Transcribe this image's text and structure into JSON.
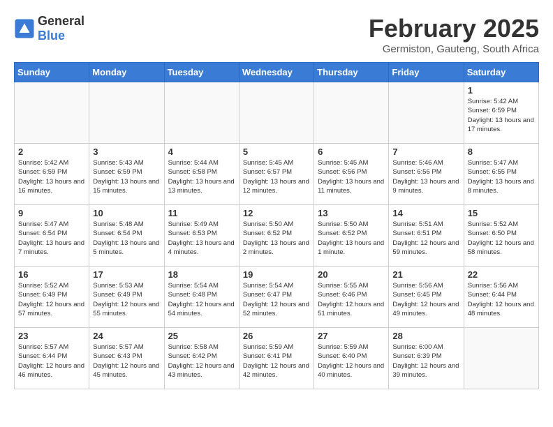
{
  "logo": {
    "general": "General",
    "blue": "Blue"
  },
  "title": "February 2025",
  "subtitle": "Germiston, Gauteng, South Africa",
  "weekdays": [
    "Sunday",
    "Monday",
    "Tuesday",
    "Wednesday",
    "Thursday",
    "Friday",
    "Saturday"
  ],
  "weeks": [
    [
      {
        "day": "",
        "info": ""
      },
      {
        "day": "",
        "info": ""
      },
      {
        "day": "",
        "info": ""
      },
      {
        "day": "",
        "info": ""
      },
      {
        "day": "",
        "info": ""
      },
      {
        "day": "",
        "info": ""
      },
      {
        "day": "1",
        "info": "Sunrise: 5:42 AM\nSunset: 6:59 PM\nDaylight: 13 hours\nand 17 minutes."
      }
    ],
    [
      {
        "day": "2",
        "info": "Sunrise: 5:42 AM\nSunset: 6:59 PM\nDaylight: 13 hours\nand 16 minutes."
      },
      {
        "day": "3",
        "info": "Sunrise: 5:43 AM\nSunset: 6:59 PM\nDaylight: 13 hours\nand 15 minutes."
      },
      {
        "day": "4",
        "info": "Sunrise: 5:44 AM\nSunset: 6:58 PM\nDaylight: 13 hours\nand 13 minutes."
      },
      {
        "day": "5",
        "info": "Sunrise: 5:45 AM\nSunset: 6:57 PM\nDaylight: 13 hours\nand 12 minutes."
      },
      {
        "day": "6",
        "info": "Sunrise: 5:45 AM\nSunset: 6:56 PM\nDaylight: 13 hours\nand 11 minutes."
      },
      {
        "day": "7",
        "info": "Sunrise: 5:46 AM\nSunset: 6:56 PM\nDaylight: 13 hours\nand 9 minutes."
      },
      {
        "day": "8",
        "info": "Sunrise: 5:47 AM\nSunset: 6:55 PM\nDaylight: 13 hours\nand 8 minutes."
      }
    ],
    [
      {
        "day": "9",
        "info": "Sunrise: 5:47 AM\nSunset: 6:54 PM\nDaylight: 13 hours\nand 7 minutes."
      },
      {
        "day": "10",
        "info": "Sunrise: 5:48 AM\nSunset: 6:54 PM\nDaylight: 13 hours\nand 5 minutes."
      },
      {
        "day": "11",
        "info": "Sunrise: 5:49 AM\nSunset: 6:53 PM\nDaylight: 13 hours\nand 4 minutes."
      },
      {
        "day": "12",
        "info": "Sunrise: 5:50 AM\nSunset: 6:52 PM\nDaylight: 13 hours\nand 2 minutes."
      },
      {
        "day": "13",
        "info": "Sunrise: 5:50 AM\nSunset: 6:52 PM\nDaylight: 13 hours\nand 1 minute."
      },
      {
        "day": "14",
        "info": "Sunrise: 5:51 AM\nSunset: 6:51 PM\nDaylight: 12 hours\nand 59 minutes."
      },
      {
        "day": "15",
        "info": "Sunrise: 5:52 AM\nSunset: 6:50 PM\nDaylight: 12 hours\nand 58 minutes."
      }
    ],
    [
      {
        "day": "16",
        "info": "Sunrise: 5:52 AM\nSunset: 6:49 PM\nDaylight: 12 hours\nand 57 minutes."
      },
      {
        "day": "17",
        "info": "Sunrise: 5:53 AM\nSunset: 6:49 PM\nDaylight: 12 hours\nand 55 minutes."
      },
      {
        "day": "18",
        "info": "Sunrise: 5:54 AM\nSunset: 6:48 PM\nDaylight: 12 hours\nand 54 minutes."
      },
      {
        "day": "19",
        "info": "Sunrise: 5:54 AM\nSunset: 6:47 PM\nDaylight: 12 hours\nand 52 minutes."
      },
      {
        "day": "20",
        "info": "Sunrise: 5:55 AM\nSunset: 6:46 PM\nDaylight: 12 hours\nand 51 minutes."
      },
      {
        "day": "21",
        "info": "Sunrise: 5:56 AM\nSunset: 6:45 PM\nDaylight: 12 hours\nand 49 minutes."
      },
      {
        "day": "22",
        "info": "Sunrise: 5:56 AM\nSunset: 6:44 PM\nDaylight: 12 hours\nand 48 minutes."
      }
    ],
    [
      {
        "day": "23",
        "info": "Sunrise: 5:57 AM\nSunset: 6:44 PM\nDaylight: 12 hours\nand 46 minutes."
      },
      {
        "day": "24",
        "info": "Sunrise: 5:57 AM\nSunset: 6:43 PM\nDaylight: 12 hours\nand 45 minutes."
      },
      {
        "day": "25",
        "info": "Sunrise: 5:58 AM\nSunset: 6:42 PM\nDaylight: 12 hours\nand 43 minutes."
      },
      {
        "day": "26",
        "info": "Sunrise: 5:59 AM\nSunset: 6:41 PM\nDaylight: 12 hours\nand 42 minutes."
      },
      {
        "day": "27",
        "info": "Sunrise: 5:59 AM\nSunset: 6:40 PM\nDaylight: 12 hours\nand 40 minutes."
      },
      {
        "day": "28",
        "info": "Sunrise: 6:00 AM\nSunset: 6:39 PM\nDaylight: 12 hours\nand 39 minutes."
      },
      {
        "day": "",
        "info": ""
      }
    ]
  ]
}
